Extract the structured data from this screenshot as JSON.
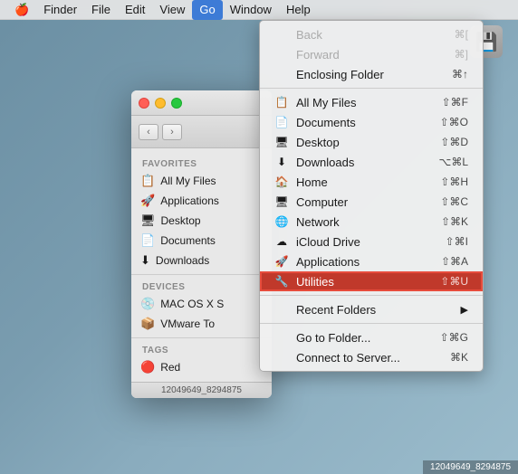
{
  "menubar": {
    "apple": "🍎",
    "items": [
      {
        "label": "Finder",
        "active": false
      },
      {
        "label": "File",
        "active": false
      },
      {
        "label": "Edit",
        "active": false
      },
      {
        "label": "View",
        "active": false
      },
      {
        "label": "Go",
        "active": true
      },
      {
        "label": "Window",
        "active": false
      },
      {
        "label": "Help",
        "active": false
      }
    ]
  },
  "finder": {
    "sidebar": {
      "favorites_label": "Favorites",
      "devices_label": "Devices",
      "tags_label": "Tags",
      "items_favorites": [
        {
          "icon": "📋",
          "label": "All My Files"
        },
        {
          "icon": "🚀",
          "label": "Applications"
        },
        {
          "icon": "🖥",
          "label": "Desktop"
        },
        {
          "icon": "📄",
          "label": "Documents"
        },
        {
          "icon": "⬇",
          "label": "Downloads"
        }
      ],
      "items_devices": [
        {
          "icon": "💿",
          "label": "MAC OS X S"
        },
        {
          "icon": "📦",
          "label": "VMware To"
        }
      ],
      "items_tags": [
        {
          "icon": "🔴",
          "label": "Red"
        }
      ]
    },
    "status": "12049649_8294875"
  },
  "go_menu": {
    "items": [
      {
        "label": "Back",
        "shortcut": "⌘[",
        "icon": "",
        "disabled": true,
        "separator_after": false
      },
      {
        "label": "Forward",
        "shortcut": "⌘]",
        "icon": "",
        "disabled": true,
        "separator_after": false
      },
      {
        "label": "Enclosing Folder",
        "shortcut": "⌘↑",
        "icon": "",
        "disabled": false,
        "separator_after": true
      },
      {
        "label": "All My Files",
        "shortcut": "⇧⌘F",
        "icon": "📋",
        "disabled": false,
        "separator_after": false
      },
      {
        "label": "Documents",
        "shortcut": "⇧⌘O",
        "icon": "📄",
        "disabled": false,
        "separator_after": false
      },
      {
        "label": "Desktop",
        "shortcut": "⇧⌘D",
        "icon": "🖥",
        "disabled": false,
        "separator_after": false
      },
      {
        "label": "Downloads",
        "shortcut": "⌥⌘L",
        "icon": "⬇",
        "disabled": false,
        "separator_after": false
      },
      {
        "label": "Home",
        "shortcut": "⇧⌘H",
        "icon": "🏠",
        "disabled": false,
        "separator_after": false
      },
      {
        "label": "Computer",
        "shortcut": "⇧⌘C",
        "icon": "🖥",
        "disabled": false,
        "separator_after": false
      },
      {
        "label": "Network",
        "shortcut": "⇧⌘K",
        "icon": "🌐",
        "disabled": false,
        "separator_after": false
      },
      {
        "label": "iCloud Drive",
        "shortcut": "⇧⌘I",
        "icon": "☁",
        "disabled": false,
        "separator_after": false
      },
      {
        "label": "Applications",
        "shortcut": "⇧⌘A",
        "icon": "🚀",
        "disabled": false,
        "separator_after": false
      },
      {
        "label": "Utilities",
        "shortcut": "⇧⌘U",
        "icon": "🔧",
        "disabled": false,
        "highlighted": true,
        "separator_after": true
      },
      {
        "label": "Recent Folders",
        "shortcut": "▶",
        "icon": "",
        "disabled": false,
        "separator_after": true
      },
      {
        "label": "Go to Folder...",
        "shortcut": "⇧⌘G",
        "icon": "",
        "disabled": false,
        "separator_after": false
      },
      {
        "label": "Connect to Server...",
        "shortcut": "⌘K",
        "icon": "",
        "disabled": false,
        "separator_after": false
      }
    ]
  }
}
